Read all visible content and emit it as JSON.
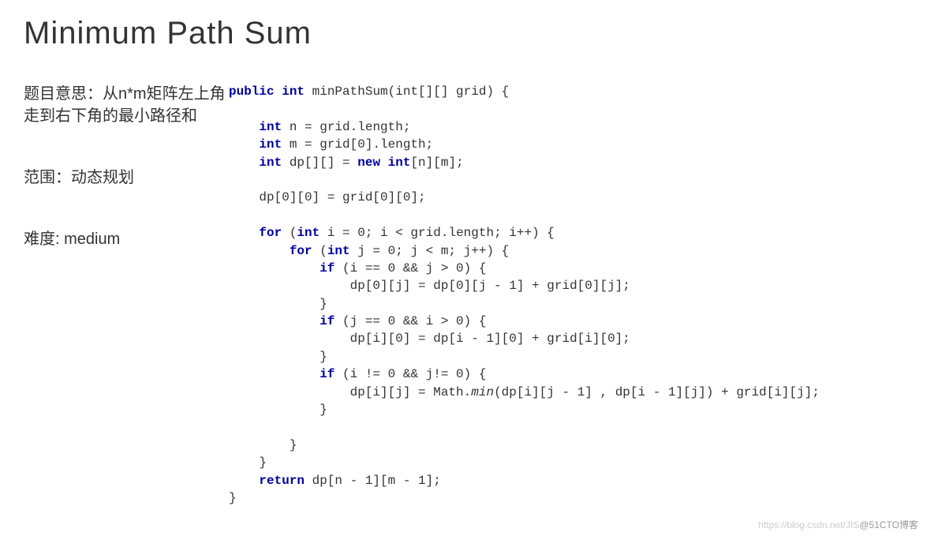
{
  "title": "Minimum Path Sum",
  "left": {
    "meaning": "题目意思：从n*m矩阵左上角走到右下角的最小路径和",
    "scope": "范围：动态规划",
    "difficulty": "难度: medium"
  },
  "code": {
    "sig_pre": "public int ",
    "sig_name": "minPathSum",
    "sig_params": "(int[][] grid) {",
    "l1a": "int",
    "l1b": " n = grid.length;",
    "l2a": "int",
    "l2b": " m = grid[0].length;",
    "l3a": "int",
    "l3b": " dp[][] = ",
    "l3c": "new int",
    "l3d": "[n][m];",
    "l4": "dp[0][0] = grid[0][0];",
    "l5a": "for",
    "l5b": " (",
    "l5c": "int",
    "l5d": " i = 0; i < grid.length; i++) {",
    "l6a": "for",
    "l6b": " (",
    "l6c": "int",
    "l6d": " j = 0; j < m; j++) {",
    "l7a": "if",
    "l7b": " (i == 0 && j > 0) {",
    "l8": "dp[0][j] = dp[0][j - 1] + grid[0][j];",
    "l9": "}",
    "l10a": "if",
    "l10b": " (j == 0 && i > 0) {",
    "l11": "dp[i][0] = dp[i - 1][0] + grid[i][0];",
    "l12": "}",
    "l13a": "if",
    "l13b": " (i != 0 && j!= 0) {",
    "l14a": "dp[i][j] = Math.",
    "l14b": "min",
    "l14c": "(dp[i][j - 1] , dp[i - 1][j]) + grid[i][j];",
    "l15": "}",
    "l16": "}",
    "l17": "}",
    "l18a": "return",
    "l18b": " dp[n - 1][m - 1];",
    "l19": "}"
  },
  "watermark": {
    "light": "https://blog.csdn.net/JIS",
    "dark": "@51CTO博客"
  }
}
